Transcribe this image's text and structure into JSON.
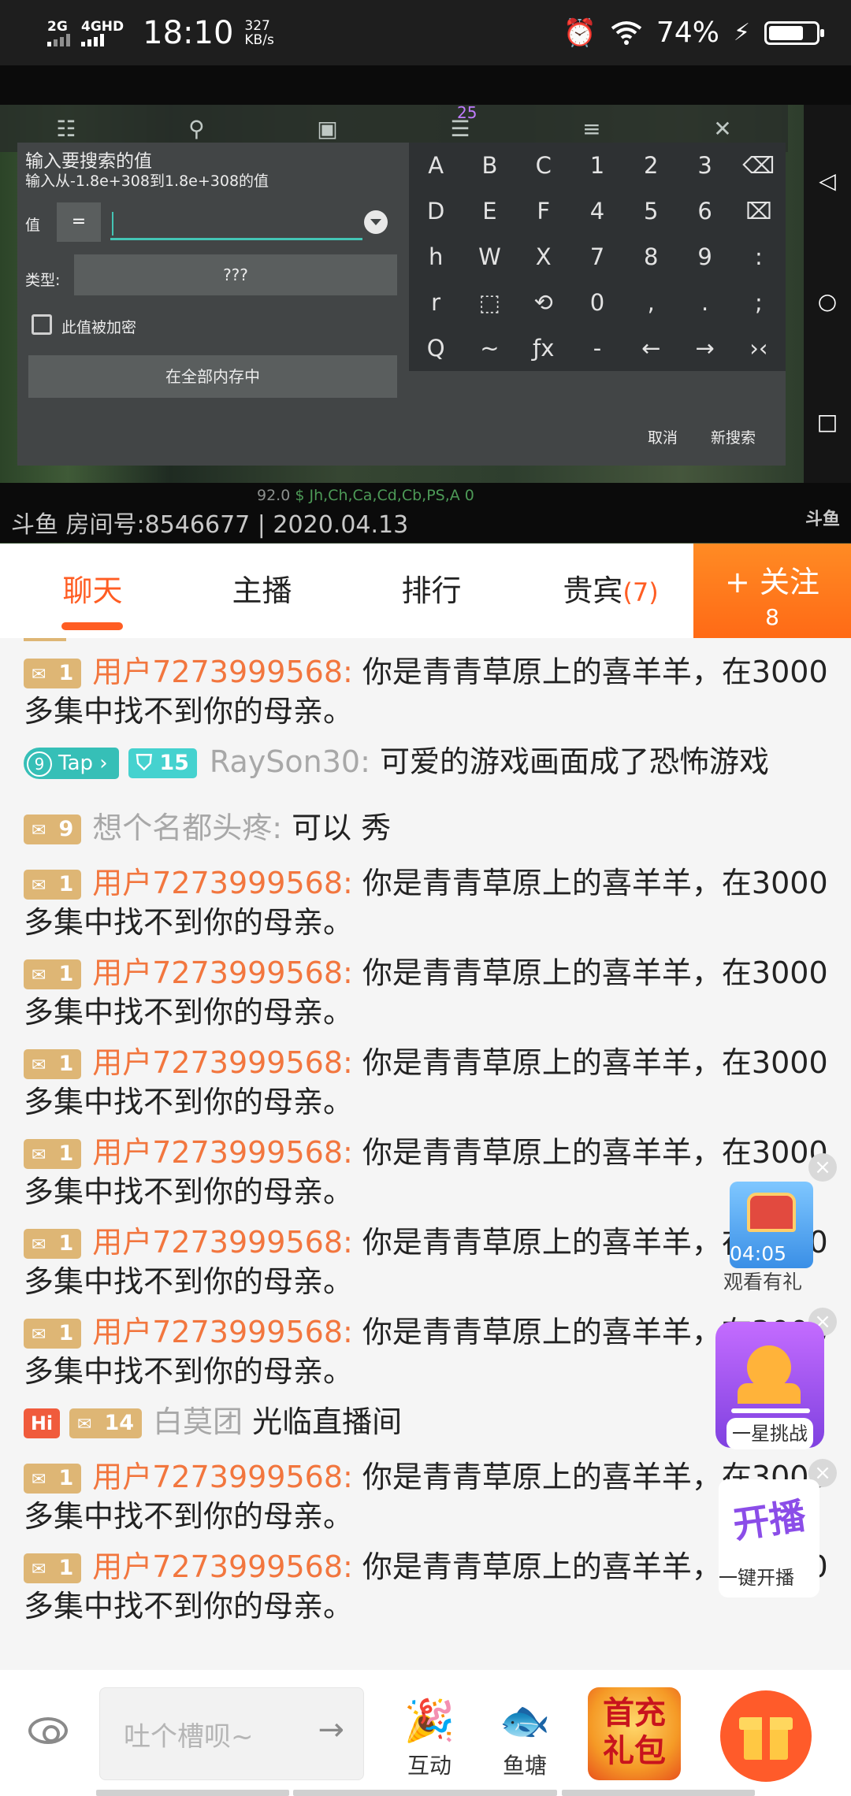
{
  "status_bar": {
    "net1": "2G",
    "net2": "4GHD",
    "time": "18:10",
    "speed_value": "327",
    "speed_unit": "KB/s",
    "battery_text": "74%",
    "battery_level": 0.74
  },
  "game_overlay": {
    "badge_count": "25",
    "search_title": "输入要搜索的值",
    "search_range": "输入从-1.8e+308到1.8e+308的值",
    "value_label": "值",
    "operator": "=",
    "type_label": "类型:",
    "type_value": "???",
    "encrypted_label": "此值被加密",
    "scope_button": "在全部内存中",
    "cancel_button": "取消",
    "new_search_button": "新搜索",
    "keypad": [
      "A",
      "B",
      "C",
      "1",
      "2",
      "3",
      "⌫",
      "D",
      "E",
      "F",
      "4",
      "5",
      "6",
      "⌧",
      "h",
      "W",
      "X",
      "7",
      "8",
      "9",
      ":",
      "r",
      "⬚",
      "⟲",
      "0",
      ",",
      ".",
      ";",
      "Q",
      "~",
      "ƒx",
      "-",
      "←",
      "→",
      "›‹"
    ],
    "status_text_prefix": "92.0",
    "status_text_currency": "$",
    "status_text_regions": "Jh,Ch,Ca,Cd,Cb,PS,A 0"
  },
  "video": {
    "room_info": "斗鱼 房间号:8546677 | 2020.04.13",
    "watermark": "斗鱼"
  },
  "tabs": {
    "items": [
      {
        "label": "聊天"
      },
      {
        "label": "主播"
      },
      {
        "label": "排行"
      },
      {
        "label": "贵宾"
      }
    ],
    "vip_count": "(7)",
    "follow_label": "+ 关注",
    "follow_count": "8"
  },
  "chat": {
    "messages": [
      {
        "badges": [
          "1"
        ],
        "user": "用户7273999568:",
        "text": "你是青青草原上的喜羊羊，在3000多集中找不到你的母亲。"
      },
      {
        "tap_level": "9",
        "tap_label": "Tap",
        "badge_teal": "15",
        "user": "RaySon30:",
        "text": "可爱的游戏画面成了恐怖游戏"
      },
      {
        "badges": [
          "9"
        ],
        "user": "想个名都头疼:",
        "text": "可以 秀"
      },
      {
        "badges": [
          "1"
        ],
        "user": "用户7273999568:",
        "text": "你是青青草原上的喜羊羊，在3000多集中找不到你的母亲。"
      },
      {
        "badges": [
          "1"
        ],
        "user": "用户7273999568:",
        "text": "你是青青草原上的喜羊羊，在3000多集中找不到你的母亲。"
      },
      {
        "badges": [
          "1"
        ],
        "user": "用户7273999568:",
        "text": "你是青青草原上的喜羊羊，在3000多集中找不到你的母亲。"
      },
      {
        "badges": [
          "1"
        ],
        "user": "用户7273999568:",
        "text": "你是青青草原上的喜羊羊，在3000多集中找不到你的母亲。"
      },
      {
        "badges": [
          "1"
        ],
        "user": "用户7273999568:",
        "text": "你是青青草原上的喜羊羊，在3000多集中找不到你的母亲。"
      },
      {
        "badges": [
          "1"
        ],
        "user": "用户7273999568:",
        "text": "你是青青草原上的喜羊羊，在3000多集中找不到你的母亲。"
      },
      {
        "hi": "Hi",
        "badges": [
          "14"
        ],
        "user": "白莫团",
        "text": "光临直播间"
      },
      {
        "badges": [
          "1"
        ],
        "user": "用户7273999568:",
        "text": "你是青青草原上的喜羊羊，在3000多集中找不到你的母亲。"
      },
      {
        "badges": [
          "1"
        ],
        "user": "用户7273999568:",
        "text": "你是青青草原上的喜羊羊，在3000多集中找不到你的母亲。"
      }
    ]
  },
  "floats": {
    "chest_timer": "04:05",
    "chest_label": "观看有礼",
    "challenge_label": "一星挑战",
    "kaibo_logo": "开播",
    "kaibo_label": "一键开播"
  },
  "bottom_bar": {
    "input_placeholder": "吐个槽呗~",
    "interact_label": "互动",
    "fishpond_label": "鱼塘",
    "recharge_line1": "首充",
    "recharge_line2": "礼包"
  },
  "colors": {
    "accent": "#ff5d23",
    "username": "#f2763e",
    "level_badge": "#deb675"
  }
}
